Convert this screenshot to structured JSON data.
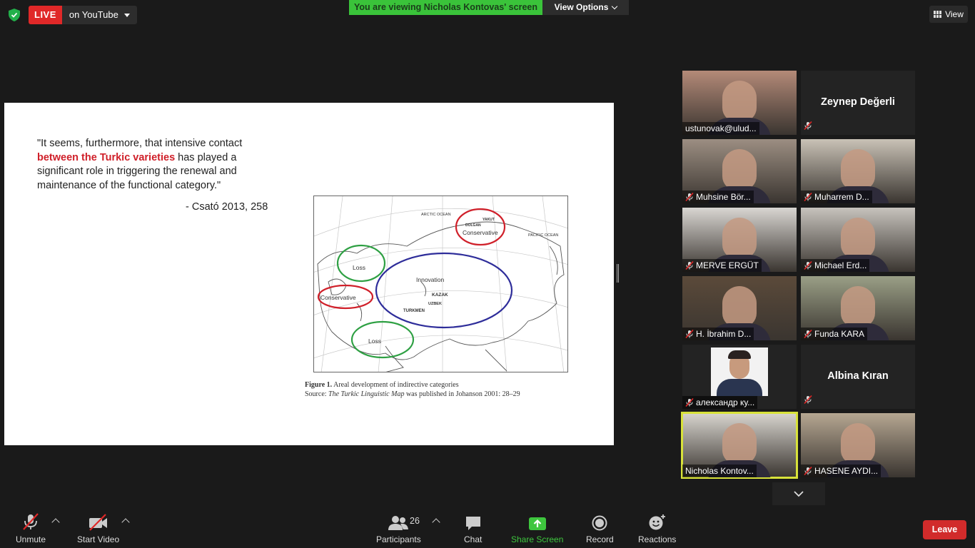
{
  "topbar": {
    "live_label": "LIVE",
    "live_target": "on YouTube",
    "viewing_banner": "You are viewing Nicholas Kontovas' screen",
    "view_options": "View Options",
    "view_label": "View"
  },
  "slide": {
    "quote_before": "\"It seems, furthermore, that intensive contact",
    "quote_highlight": "between the Turkic varieties",
    "quote_after": "has played a significant role in triggering the renewal and maintenance of the functional category.\"",
    "citation": "- Csató 2013, 258",
    "map_labels": {
      "conservative_ne": "Conservative",
      "loss_west": "Loss",
      "innovation": "Innovation",
      "conservative_sw": "Conservative",
      "loss_south": "Loss",
      "arctic": "ARCTIC OCEAN",
      "pacific": "PACIFIC OCEAN",
      "kazak": "KAZAK",
      "turkmen": "TURKMEN",
      "uzbek": "UZBEK",
      "dolgan": "DOLGAN",
      "yakut": "YAKUT"
    },
    "figure_label": "Figure 1.",
    "figure_title": "Areal development of indirective categories",
    "source_prefix": "Source:",
    "source_title": "The Turkic Linguistic Map",
    "source_suffix": "was published in Johanson 2001: 28–29"
  },
  "participants": [
    {
      "name": "ustunovak@ulud...",
      "video": true,
      "muted": false,
      "bg": "#b48a78"
    },
    {
      "name": "Zeynep Değerli",
      "video": false,
      "muted": true
    },
    {
      "name": "Muhsine Bör...",
      "video": true,
      "muted": true,
      "bg": "#9c8e82"
    },
    {
      "name": "Muharrem D...",
      "video": true,
      "muted": true,
      "bg": "#c9c2b6"
    },
    {
      "name": "MERVE ERGÜT",
      "video": true,
      "muted": true,
      "bg": "#d9d6d2"
    },
    {
      "name": "Michael Erd...",
      "video": true,
      "muted": true,
      "bg": "#c7c3bd"
    },
    {
      "name": "H. İbrahim D...",
      "video": true,
      "muted": true,
      "bg": "#5b4a3a"
    },
    {
      "name": "Funda KARA",
      "video": true,
      "muted": true,
      "bg": "#9a9f86"
    },
    {
      "name": "александр ку...",
      "video": false,
      "photo": true,
      "muted": true
    },
    {
      "name": "Albina Kıran",
      "video": false,
      "muted": true
    },
    {
      "name": "Nicholas Kontov...",
      "video": true,
      "muted": false,
      "active": true,
      "bg": "#d8d5cf"
    },
    {
      "name": "HASENE AYDI...",
      "video": true,
      "muted": true,
      "bg": "#b6a792"
    }
  ],
  "toolbar": {
    "unmute": "Unmute",
    "start_video": "Start Video",
    "participants": "Participants",
    "participants_count": "26",
    "chat": "Chat",
    "share_screen": "Share Screen",
    "record": "Record",
    "reactions": "Reactions",
    "leave": "Leave"
  },
  "colors": {
    "live_red": "#e02828",
    "banner_green": "#3ac33a",
    "share_green": "#3ec63e",
    "leave_red": "#d12b2b",
    "active_speaker": "#d8e23a",
    "quote_highlight": "#d0202a"
  }
}
